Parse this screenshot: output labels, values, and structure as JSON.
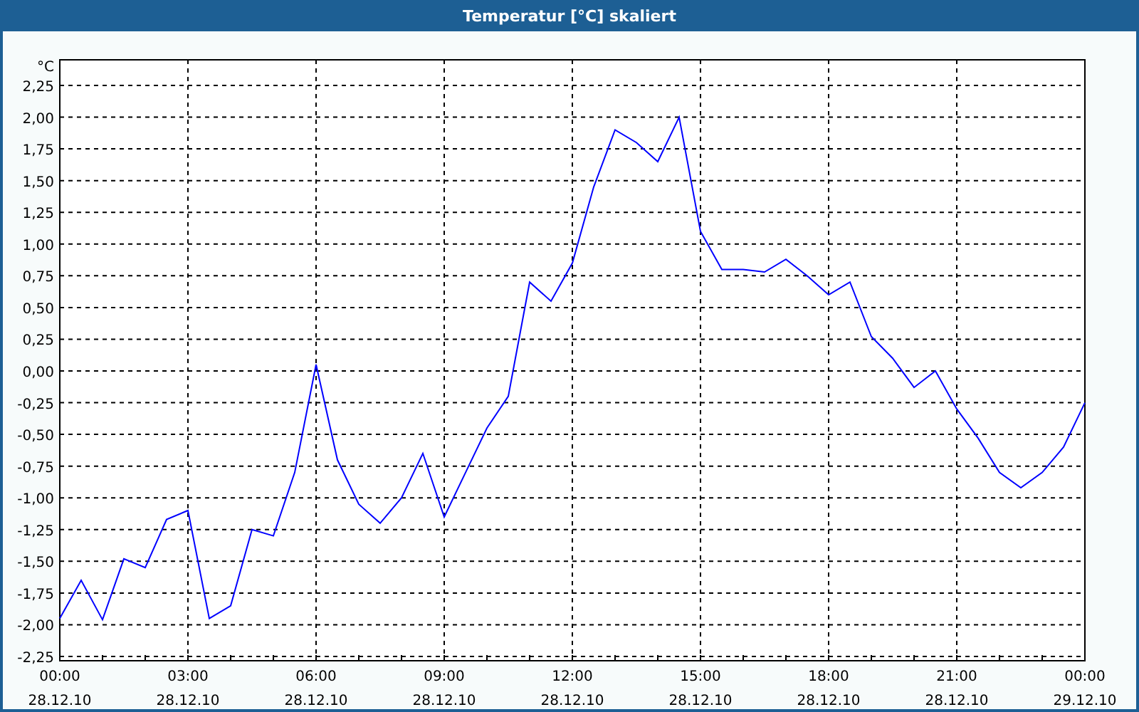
{
  "window": {
    "title": "Temperatur [°C] skaliert"
  },
  "chart_data": {
    "type": "line",
    "ylabel": "°C",
    "grid": true,
    "categories": [
      "00:00 28.12.10",
      null,
      null,
      null,
      null,
      null,
      "03:00 28.12.10",
      null,
      null,
      null,
      null,
      null,
      "06:00 28.12.10",
      null,
      null,
      null,
      null,
      null,
      "09:00 28.12.10",
      null,
      null,
      null,
      null,
      null,
      "12:00 28.12.10",
      null,
      null,
      null,
      null,
      null,
      "15:00 28.12.10",
      null,
      null,
      null,
      null,
      null,
      "18:00 28.12.10",
      null,
      null,
      null,
      null,
      null,
      "21:00 28.12.10",
      null,
      null,
      null,
      null,
      null,
      "00:00 29.12.10"
    ],
    "values": [
      -1.95,
      -1.65,
      -1.96,
      -1.48,
      -1.55,
      -1.17,
      -1.1,
      -1.95,
      -1.85,
      -1.25,
      -1.3,
      -0.8,
      0.05,
      -0.7,
      -1.05,
      -1.2,
      -1.0,
      -0.65,
      -1.15,
      -0.8,
      -0.45,
      -0.2,
      0.7,
      0.55,
      0.85,
      1.45,
      1.9,
      1.8,
      1.65,
      2.0,
      1.1,
      0.8,
      0.8,
      0.78,
      0.88,
      0.75,
      0.6,
      0.7,
      0.27,
      0.1,
      -0.13,
      0.0,
      -0.3,
      -0.53,
      -0.8,
      -0.92,
      -0.8,
      -0.6,
      -0.25
    ],
    "ylim": [
      -2.25,
      2.25
    ],
    "yticks": [
      {
        "value": 2.25,
        "label": "2,25"
      },
      {
        "value": 2,
        "label": "2,00"
      },
      {
        "value": 1.75,
        "label": "1,75"
      },
      {
        "value": 1.5,
        "label": "1,50"
      },
      {
        "value": 1.25,
        "label": "1,25"
      },
      {
        "value": 1,
        "label": "1,00"
      },
      {
        "value": 0.75,
        "label": "0,75"
      },
      {
        "value": 0.5,
        "label": "0,50"
      },
      {
        "value": 0.25,
        "label": "0,25"
      },
      {
        "value": 0,
        "label": "0,00"
      },
      {
        "value": -0.25,
        "label": "-0,25"
      },
      {
        "value": -0.5,
        "label": "-0,50"
      },
      {
        "value": -0.75,
        "label": "-0,75"
      },
      {
        "value": -1,
        "label": "-1,00"
      },
      {
        "value": -1.25,
        "label": "-1,25"
      },
      {
        "value": -1.5,
        "label": "-1,50"
      },
      {
        "value": -1.75,
        "label": "-1,75"
      },
      {
        "value": -2,
        "label": "-2,00"
      },
      {
        "value": -2.25,
        "label": "-2,25"
      }
    ]
  }
}
